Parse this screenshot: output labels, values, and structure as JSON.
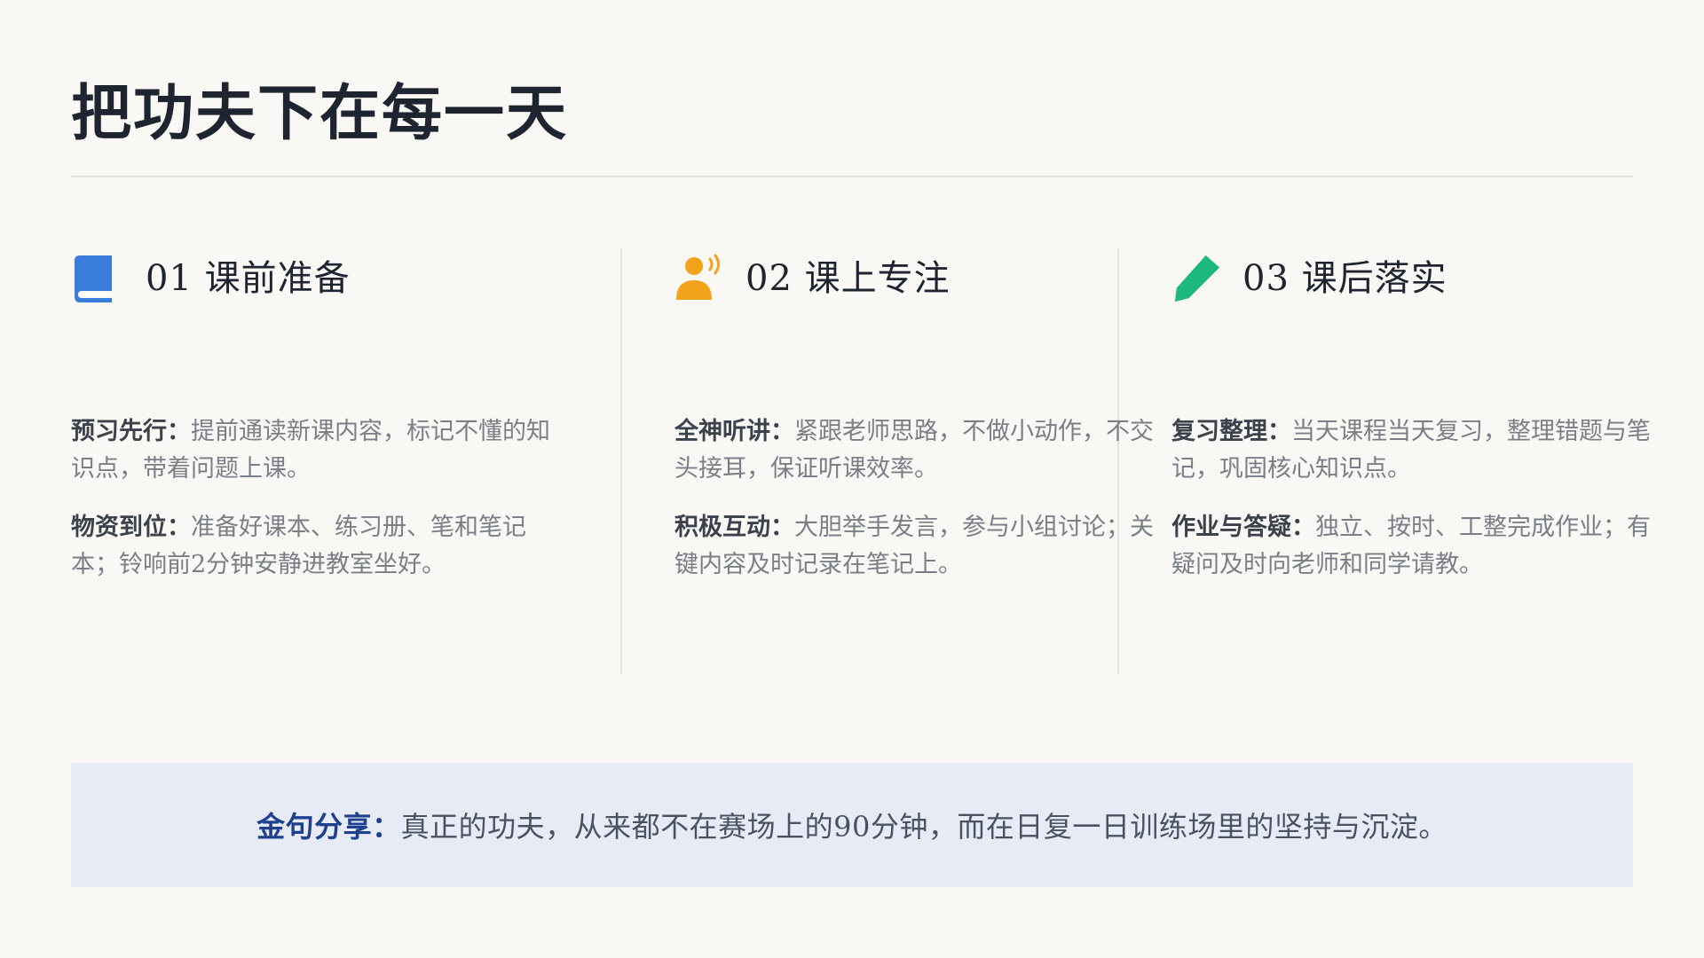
{
  "page": {
    "title": "把功夫下在每一天"
  },
  "columns": [
    {
      "icon": "book-icon",
      "heading": "01 课前准备",
      "accent": "#3b7ddd",
      "items": [
        {
          "label": "预习先行：",
          "text": "提前通读新课内容，标记不懂的知识点，带着问题上课。"
        },
        {
          "label": "物资到位：",
          "text": "准备好课本、练习册、笔和笔记本；铃响前2分钟安静进教室坐好。"
        }
      ]
    },
    {
      "icon": "listening-person-icon",
      "heading": "02 课上专注",
      "accent": "#f2a21b",
      "items": [
        {
          "label": "全神听讲：",
          "text": "紧跟老师思路，不做小动作，不交头接耳，保证听课效率。"
        },
        {
          "label": "积极互动：",
          "text": "大胆举手发言，参与小组讨论；关键内容及时记录在笔记上。"
        }
      ]
    },
    {
      "icon": "pencil-icon",
      "heading": "03 课后落实",
      "accent": "#1db87f",
      "items": [
        {
          "label": "复习整理：",
          "text": "当天课程当天复习，整理错题与笔记，巩固核心知识点。"
        },
        {
          "label": "作业与答疑：",
          "text": "独立、按时、工整完成作业；有疑问及时向老师和同学请教。"
        }
      ]
    }
  ],
  "quote": {
    "label": "金句分享：",
    "text": "真正的功夫，从来都不在赛场上的90分钟，而在日复一日训练场里的坚持与沉淀。"
  },
  "colors": {
    "background": "#f9f8f5",
    "quote_background": "#e6ebf5",
    "quote_label": "#1f3f8f"
  }
}
